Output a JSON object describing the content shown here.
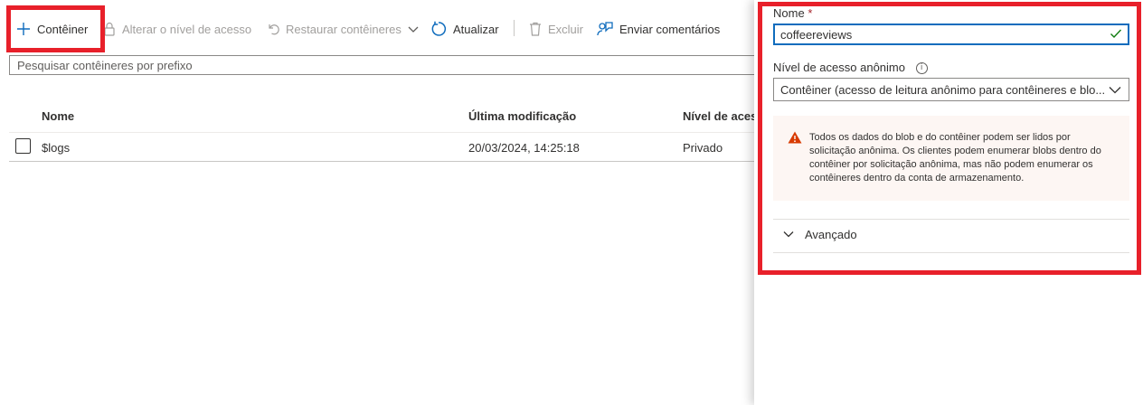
{
  "toolbar": {
    "container_label": "Contêiner",
    "change_access_label": "Alterar o nível de acesso",
    "restore_label": "Restaurar contêineres",
    "refresh_label": "Atualizar",
    "delete_label": "Excluir",
    "feedback_label": "Enviar comentários"
  },
  "search": {
    "placeholder": "Pesquisar contêineres por prefixo"
  },
  "table": {
    "columns": [
      "Nome",
      "Última modificação",
      "Nível de acess"
    ],
    "rows": [
      {
        "name": "$logs",
        "modified": "20/03/2024, 14:25:18",
        "access": "Privado"
      }
    ]
  },
  "panel": {
    "name_label": "Nome",
    "required_mark": "*",
    "name_value": "coffeereviews",
    "access_label": "Nível de acesso anônimo",
    "access_value": "Contêiner (acesso de leitura anônimo para contêineres e blo...",
    "warning_text": "Todos os dados do blob e do contêiner podem ser lidos por solicitação anônima. Os clientes podem enumerar blobs dentro do contêiner por solicitação anônima, mas não podem enumerar os contêineres dentro da conta de armazenamento.",
    "advanced_label": "Avançado"
  },
  "colors": {
    "highlight": "#e8202a",
    "accent": "#0f6cbd",
    "success": "#107c10",
    "warning": "#d83b01"
  }
}
